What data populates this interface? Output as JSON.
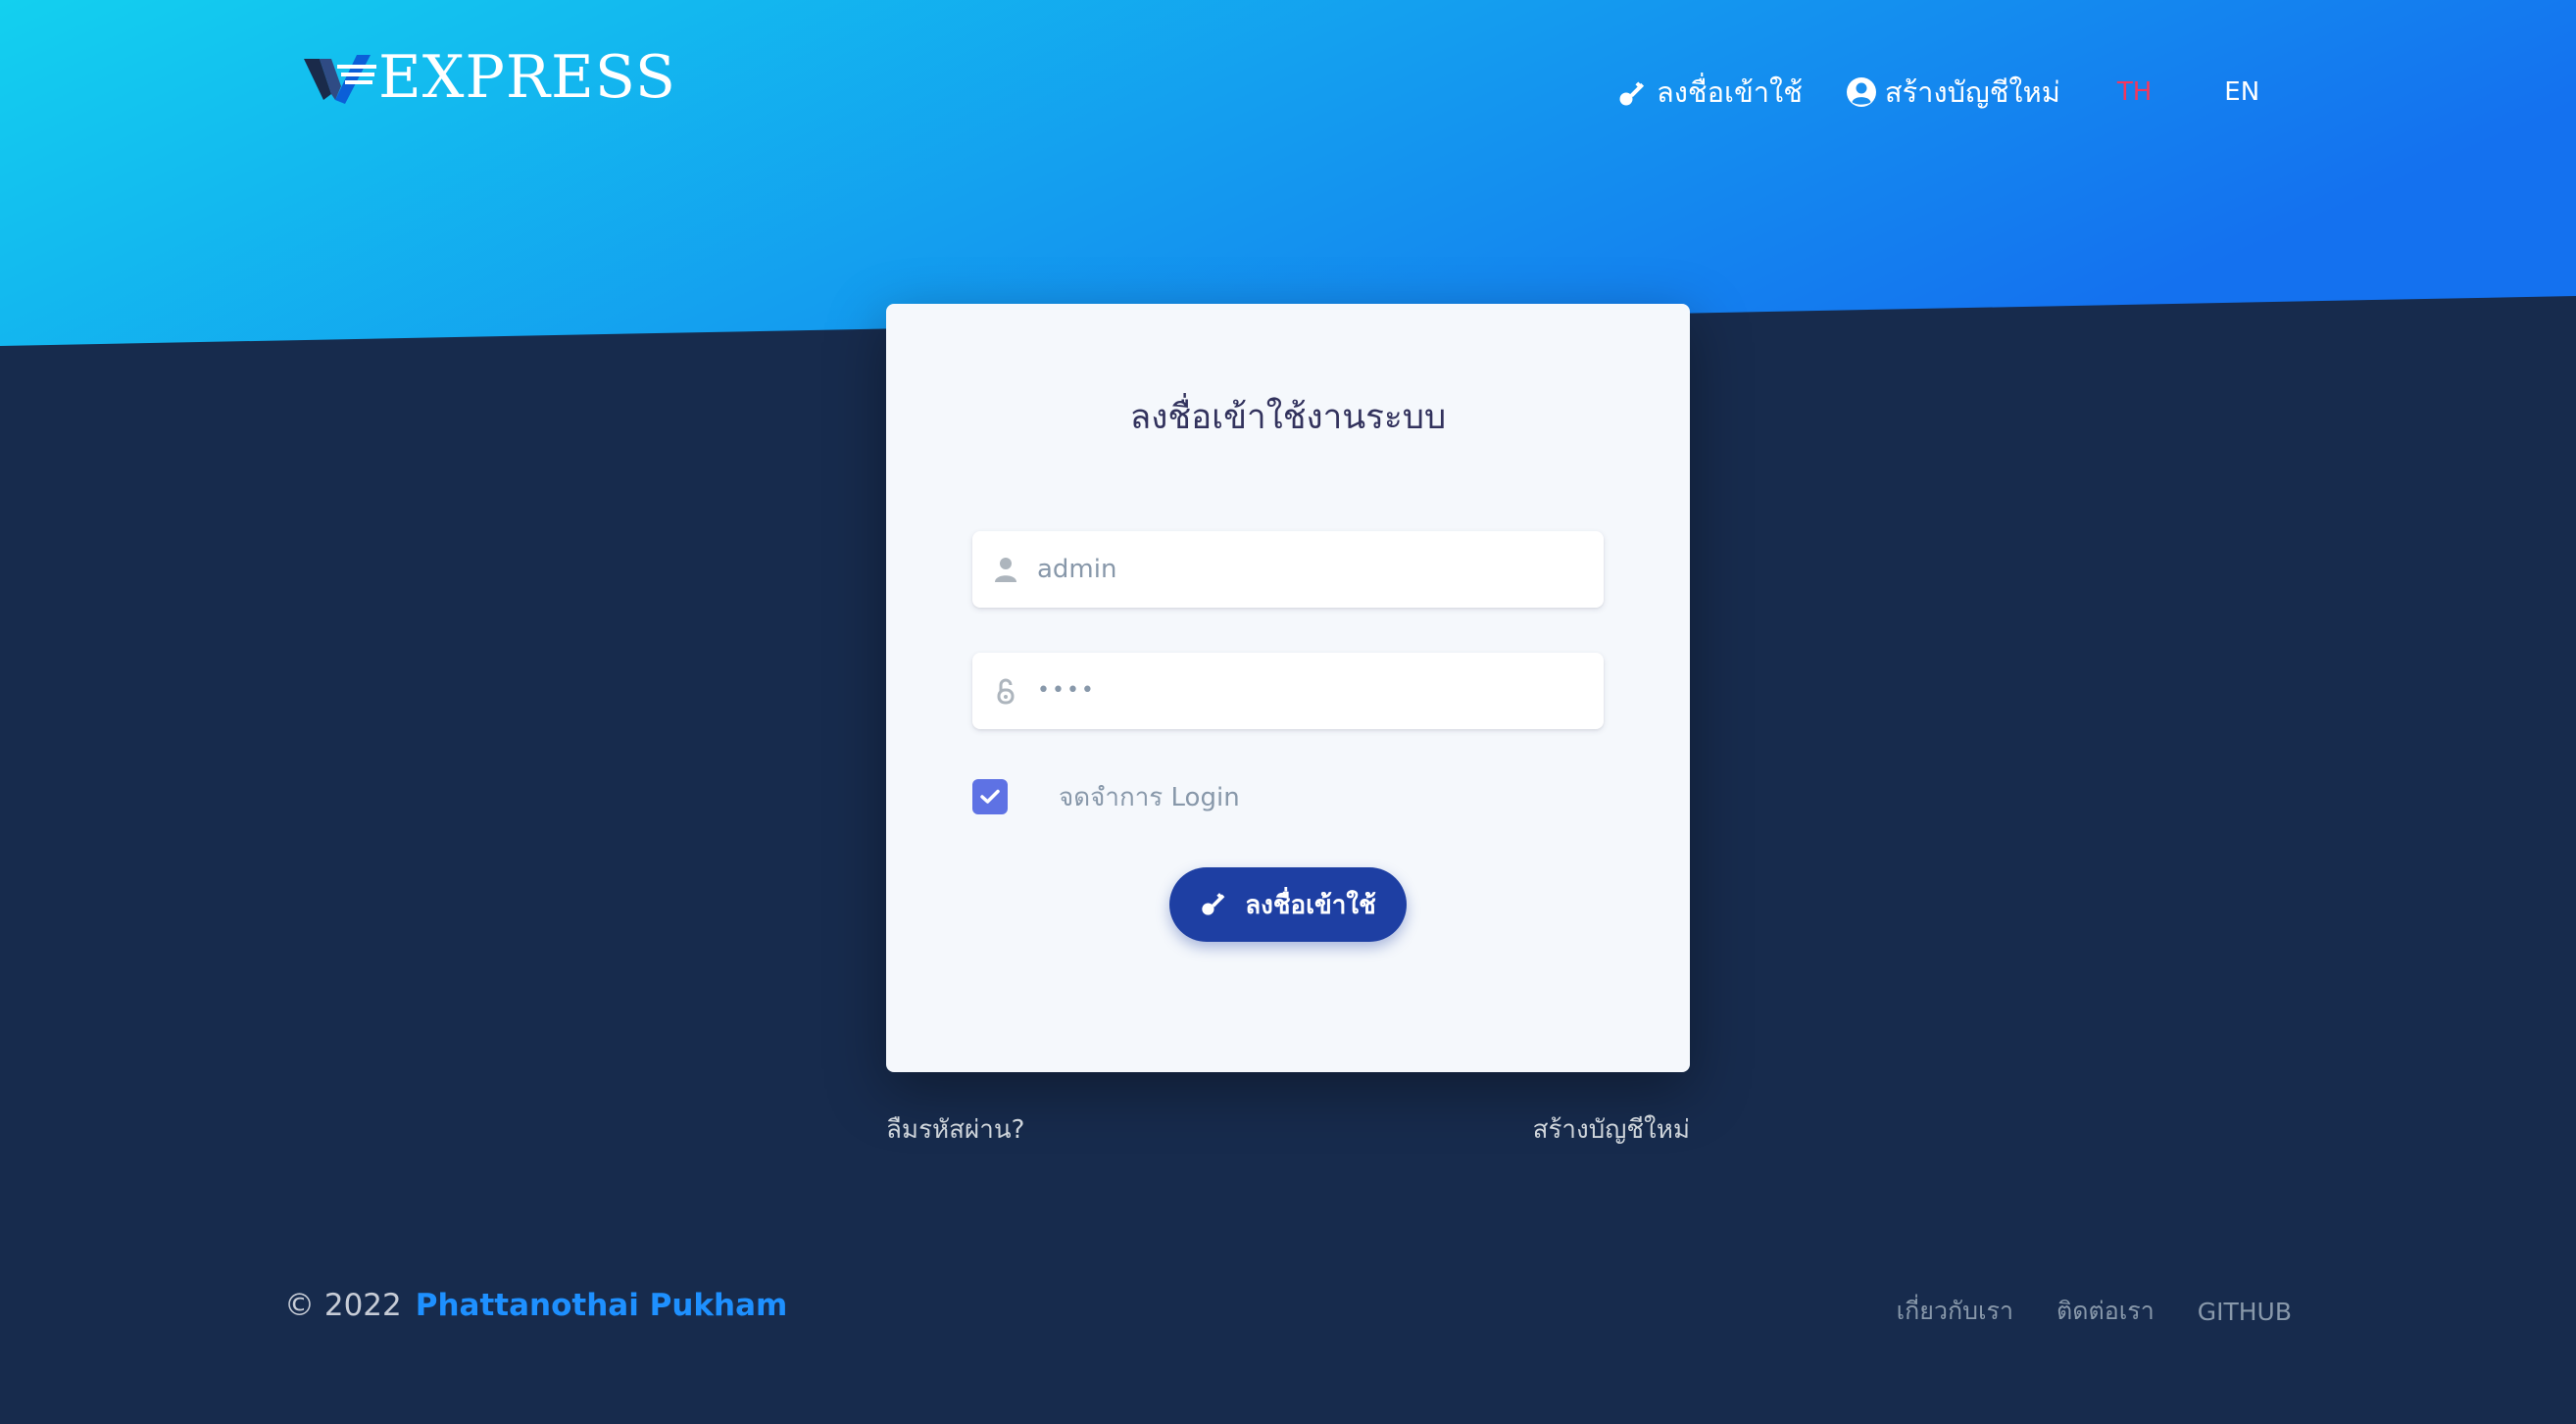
{
  "brand": {
    "logo_text": "EXPRESS"
  },
  "navbar": {
    "login_label": "ลงชื่อเข้าใช้",
    "login_icon": "key-icon",
    "register_label": "สร้างบัญชีใหม่",
    "register_icon": "user-circle-icon",
    "languages": [
      {
        "code": "TH",
        "active": true,
        "color": "#f5365c"
      },
      {
        "code": "EN",
        "active": false,
        "color": "#ffffff"
      }
    ]
  },
  "login_card": {
    "title": "ลงชื่อเข้าใช้งานระบบ",
    "username": {
      "value": "admin",
      "icon": "user-icon"
    },
    "password": {
      "value": "••••",
      "icon": "unlock-icon"
    },
    "remember": {
      "label": "จดจำการ Login",
      "checked": true
    },
    "submit_label": "ลงชื่อเข้าใช้",
    "submit_icon": "key-icon"
  },
  "below_links": {
    "forgot_password": "ลืมรหัสผ่าน?",
    "create_account": "สร้างบัญชีใหม่"
  },
  "footer": {
    "copyright": "© 2022",
    "author": "Phattanothai Pukham",
    "links": [
      "เกี่ยวกับเรา",
      "ติดต่อเรา",
      "GITHUB"
    ]
  },
  "colors": {
    "hero_gradient_start": "#13d0ef",
    "hero_gradient_end": "#1471ef",
    "background": "#172b4d",
    "card_background": "#f5f8fc",
    "primary_button": "#1e3fa3",
    "checkbox": "#5e72e4",
    "author_link": "#1e90ff",
    "active_language": "#f5365c"
  }
}
